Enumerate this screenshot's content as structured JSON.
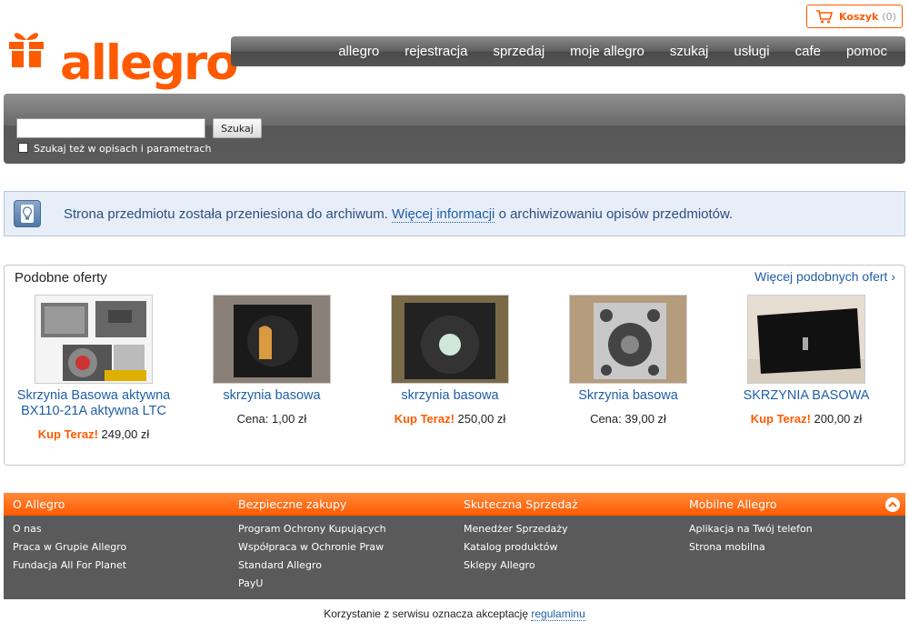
{
  "header": {
    "logo_text": "allegro",
    "cart": {
      "label": "Koszyk",
      "count": "(0)"
    },
    "nav": [
      "allegro",
      "rejestracja",
      "sprzedaj",
      "moje allegro",
      "szukaj",
      "usługi",
      "cafe",
      "pomoc"
    ]
  },
  "search": {
    "input_value": "",
    "button_label": "Szukaj",
    "checkbox_label": "Szukaj też w opisach i parametrach"
  },
  "info": {
    "text_before": "Strona przedmiotu została przeniesiona do archiwum.",
    "link": "Więcej informacji",
    "text_after": "o archiwizowaniu opisów przedmiotów."
  },
  "similar": {
    "title": "Podobne oferty",
    "more_link": "Więcej podobnych ofert ›",
    "offers": [
      {
        "title": "Skrzynia Basowa aktywna BX110-21A aktywna LTC",
        "price_label": "Kup Teraz!",
        "price": "249,00 zł",
        "buy_now": true
      },
      {
        "title": "skrzynia basowa",
        "price_label": "Cena:",
        "price": "1,00 zł",
        "buy_now": false
      },
      {
        "title": "skrzynia basowa",
        "price_label": "Kup Teraz!",
        "price": "250,00 zł",
        "buy_now": true
      },
      {
        "title": "Skrzynia basowa",
        "price_label": "Cena:",
        "price": "39,00 zł",
        "buy_now": false
      },
      {
        "title": "SKRZYNIA BASOWA",
        "price_label": "Kup Teraz!",
        "price": "200,00 zł",
        "buy_now": true
      }
    ]
  },
  "footer": {
    "columns": [
      {
        "title": "O Allegro",
        "links": [
          "O nas",
          "Praca w Grupie Allegro",
          "Fundacja All For Planet"
        ]
      },
      {
        "title": "Bezpieczne zakupy",
        "links": [
          "Program Ochrony Kupujących",
          "Współpraca w Ochronie Praw",
          "Standard Allegro",
          "PayU"
        ]
      },
      {
        "title": "Skuteczna Sprzedaż",
        "links": [
          "Menedżer Sprzedaży",
          "Katalog produktów",
          "Sklepy Allegro"
        ]
      },
      {
        "title": "Mobilne Allegro",
        "links": [
          "Aplikacja na Twój telefon",
          "Strona mobilna"
        ]
      }
    ],
    "legal_text": "Korzystanie z serwisu oznacza akceptację",
    "legal_link": "regulaminu"
  },
  "colors": {
    "brand": "#ff5a00",
    "link": "#1f5ea8",
    "info_bg": "#e8eef8"
  }
}
